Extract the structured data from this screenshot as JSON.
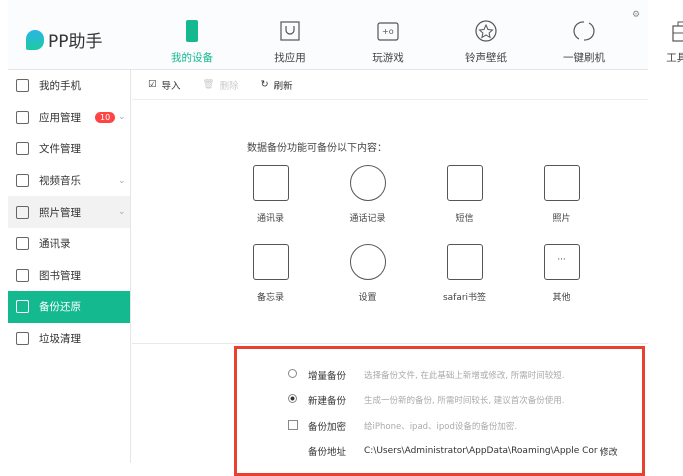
{
  "app": {
    "name": "PP助手"
  },
  "nav": [
    {
      "label": "我的设备",
      "icon": "phone-icon",
      "active": true
    },
    {
      "label": "找应用",
      "icon": "bag-icon"
    },
    {
      "label": "玩游戏",
      "icon": "gamepad-icon"
    },
    {
      "label": "铃声壁纸",
      "icon": "star-icon"
    },
    {
      "label": "一键刷机",
      "icon": "refresh-icon"
    },
    {
      "label": "工具箱",
      "icon": "toolbox-icon"
    }
  ],
  "sidebar": [
    {
      "label": "我的手机"
    },
    {
      "label": "应用管理",
      "badge": "10",
      "chevron": true
    },
    {
      "label": "文件管理"
    },
    {
      "label": "视频音乐",
      "chevron": true
    },
    {
      "label": "照片管理",
      "chevron": true
    },
    {
      "label": "通讯录"
    },
    {
      "label": "图书管理"
    },
    {
      "label": "备份还原",
      "active": true
    },
    {
      "label": "垃圾清理"
    }
  ],
  "toolbar": {
    "import": "导入",
    "delete": "删除",
    "refresh": "刷新"
  },
  "main": {
    "title": "数据备份功能可备份以下内容：",
    "items": [
      {
        "label": "通讯录"
      },
      {
        "label": "通话记录"
      },
      {
        "label": "短信"
      },
      {
        "label": "照片"
      },
      {
        "label": "备忘录"
      },
      {
        "label": "设置"
      },
      {
        "label": "safari书签"
      },
      {
        "label": "其他"
      }
    ]
  },
  "options": {
    "incremental": {
      "label": "增量备份",
      "desc": "选择备份文件, 在此基础上新增或修改, 所需时间较短.",
      "selected": false
    },
    "new": {
      "label": "新建备份",
      "desc": "生成一份新的备份, 所需时间较长, 建议首次备份使用.",
      "selected": true
    },
    "encrypt": {
      "label": "备份加密",
      "desc": "给iPhone、ipad、ipod设备的备份加密.",
      "checked": false
    },
    "path": {
      "label": "备份地址",
      "value": "C:\\Users\\Administrator\\AppData\\Roaming\\Apple Cor",
      "modify": "修改"
    }
  },
  "colors": {
    "accent": "#14b990",
    "highlight": "#e8412f",
    "badge": "#ff4444"
  }
}
